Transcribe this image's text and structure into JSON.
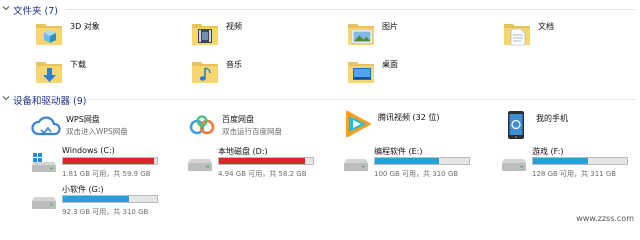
{
  "sections": {
    "folders": {
      "title": "文件夹 (7)"
    },
    "devices": {
      "title": "设备和驱动器 (9)"
    }
  },
  "folders": [
    {
      "label": "3D 对象",
      "icon": "3d-objects-folder-icon"
    },
    {
      "label": "视频",
      "icon": "videos-folder-icon"
    },
    {
      "label": "图片",
      "icon": "pictures-folder-icon"
    },
    {
      "label": "文档",
      "icon": "documents-folder-icon"
    },
    {
      "label": "下载",
      "icon": "downloads-folder-icon"
    },
    {
      "label": "音乐",
      "icon": "music-folder-icon"
    },
    {
      "label": "桌面",
      "icon": "desktop-folder-icon"
    }
  ],
  "devices": [
    {
      "label": "WPS网盘",
      "sub": "双击进入WPS网盘",
      "icon": "cloud-icon"
    },
    {
      "label": "百度网盘",
      "sub": "双击运行百度网盘",
      "icon": "baidu-netdisk-icon"
    },
    {
      "label": "腾讯视频 (32 位)",
      "sub": "",
      "icon": "tencent-video-icon"
    },
    {
      "label": "我的手机",
      "sub": "",
      "icon": "phone-icon"
    }
  ],
  "drives": [
    {
      "label": "Windows (C:)",
      "info": "1.81 GB 可用，共 59.9 GB",
      "used_fraction": 0.97,
      "color": "#da2626",
      "icon": "windows-drive-icon"
    },
    {
      "label": "本地磁盘 (D:)",
      "info": "4.94 GB 可用，共 58.2 GB",
      "used_fraction": 0.92,
      "color": "#da2626",
      "icon": "hard-drive-icon"
    },
    {
      "label": "编程软件 (E:)",
      "info": "100 GB 可用，共 310 GB",
      "used_fraction": 0.68,
      "color": "#26a0da",
      "icon": "hard-drive-icon"
    },
    {
      "label": "游戏 (F:)",
      "info": "128 GB 可用，共 311 GB",
      "used_fraction": 0.59,
      "color": "#26a0da",
      "icon": "hard-drive-icon"
    },
    {
      "label": "小软件 (G:)",
      "info": "92.3 GB 可用，共 310 GB",
      "used_fraction": 0.7,
      "color": "#26a0da",
      "icon": "hard-drive-icon"
    }
  ],
  "watermark": "www.zzss.com"
}
